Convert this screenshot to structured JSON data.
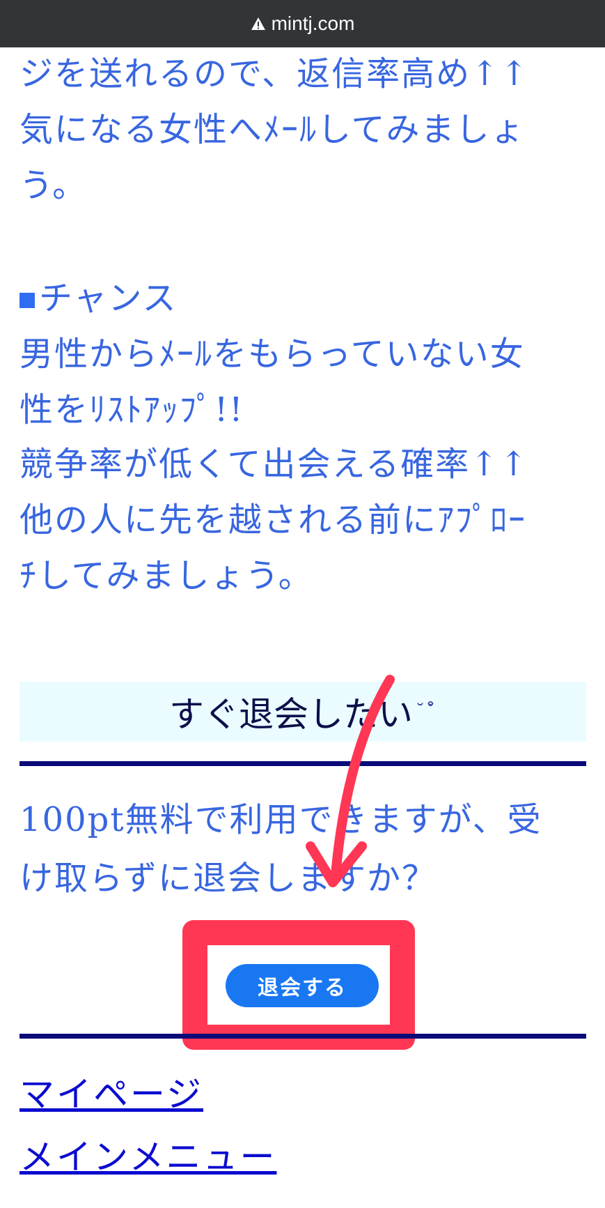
{
  "browser": {
    "url": "mintj.com"
  },
  "body_lines": {
    "l1": "ジを送れるので、返信率高め↑↑",
    "l2": "気になる女性へﾒｰﾙしてみましょ",
    "l3": "う。",
    "l4_heading": "チャンス",
    "l5": "男性からﾒｰﾙをもらっていない女",
    "l6": "性をﾘｽﾄｱｯﾌﾟ!!",
    "l7": "競争率が低くて出会える確率↑↑",
    "l8": "他の人に先を越される前にｱﾌﾟﾛｰ",
    "l9": "ﾁしてみましょう。"
  },
  "banner": {
    "title": "すぐ退会したい",
    "emoji": "˘˘̊"
  },
  "notice": {
    "line1": "100pt無料で利用できますが、受",
    "line2": "け取らずに退会しますか？"
  },
  "actions": {
    "withdraw_label": "退会する"
  },
  "links": {
    "mypage": "マイページ",
    "main_menu": "メインメニュー"
  },
  "colors": {
    "body_text": "#3866e0",
    "rule": "#0a0a78",
    "banner_bg": "#eafcff",
    "button": "#1a77f2",
    "highlight": "#ff3754",
    "link": "#0b0bd0"
  }
}
